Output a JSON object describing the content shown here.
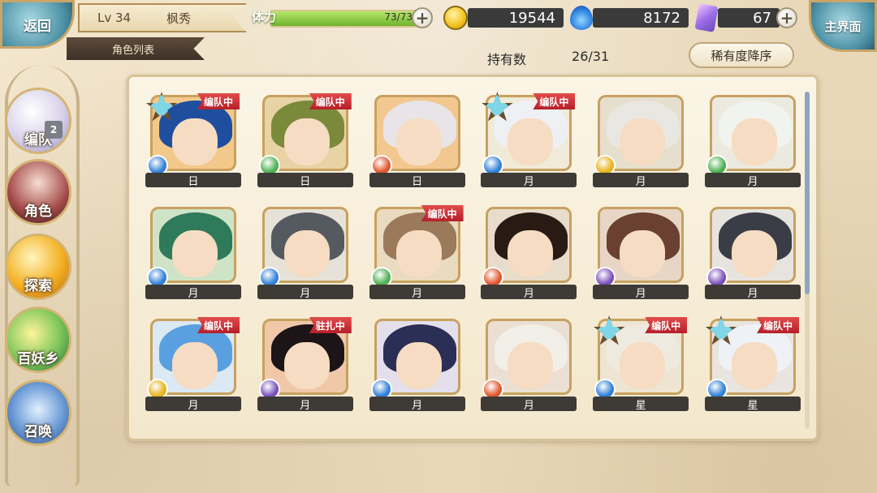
{
  "header": {
    "back_label": "返回",
    "level": "Lv 34",
    "player_name": "枫秀",
    "section_tab": "角色列表",
    "stamina_label": "体力",
    "stamina_value": "73/73",
    "stamina_fraction": 1.0,
    "gold": "19544",
    "spirit": "8172",
    "gems": "67",
    "home_label": "主界面"
  },
  "toolbar": {
    "owned_label": "持有数",
    "owned_value": "26/31",
    "sort_label": "稀有度降序"
  },
  "sidebar": {
    "items": [
      {
        "label": "编队",
        "badge": "2"
      },
      {
        "label": "角色"
      },
      {
        "label": "探索"
      },
      {
        "label": "百妖乡"
      },
      {
        "label": "召唤"
      }
    ]
  },
  "colors": {
    "badge_red": "#c8323a",
    "frame_gold": "#c8a15f",
    "element_water": "#2f7fd6",
    "element_wind": "#4caf50",
    "element_fire": "#e0542a",
    "element_light": "#e8b21a",
    "element_dark": "#7a4fb8"
  },
  "characters": [
    {
      "rank": "日",
      "badge": "编队中",
      "star": true,
      "element": "water",
      "hair": "#1f4e9e",
      "bg": "#f3c98b"
    },
    {
      "rank": "日",
      "badge": "编队中",
      "star": false,
      "element": "wind",
      "hair": "#7a8a3a",
      "bg": "#e8d3a4"
    },
    {
      "rank": "日",
      "badge": "",
      "star": false,
      "element": "fire",
      "hair": "#e8e4e8",
      "bg": "#f2c890"
    },
    {
      "rank": "月",
      "badge": "编队中",
      "star": true,
      "element": "water",
      "hair": "#eef0f4",
      "bg": "#f0ead8"
    },
    {
      "rank": "月",
      "badge": "",
      "star": false,
      "element": "light",
      "hair": "#e9e7e2",
      "bg": "#e6dfcd"
    },
    {
      "rank": "月",
      "badge": "",
      "star": false,
      "element": "wind",
      "hair": "#f1f3ef",
      "bg": "#eceadf"
    },
    {
      "rank": "月",
      "badge": "",
      "star": false,
      "element": "water",
      "hair": "#2e7a5a",
      "bg": "#cfe3c6"
    },
    {
      "rank": "月",
      "badge": "",
      "star": false,
      "element": "water",
      "hair": "#555a60",
      "bg": "#e6e2d8"
    },
    {
      "rank": "月",
      "badge": "编队中",
      "star": false,
      "element": "wind",
      "hair": "#9a7a5a",
      "bg": "#eadac0"
    },
    {
      "rank": "月",
      "badge": "",
      "star": false,
      "element": "fire",
      "hair": "#2a1a14",
      "bg": "#e8dccb"
    },
    {
      "rank": "月",
      "badge": "",
      "star": false,
      "element": "dark",
      "hair": "#6a4030",
      "bg": "#e7d6c5"
    },
    {
      "rank": "月",
      "badge": "",
      "star": false,
      "element": "dark",
      "hair": "#3a3d45",
      "bg": "#e7e4df"
    },
    {
      "rank": "月",
      "badge": "编队中",
      "star": false,
      "element": "light",
      "hair": "#5aa0e0",
      "bg": "#dbe9f4"
    },
    {
      "rank": "月",
      "badge": "驻扎中",
      "star": false,
      "element": "dark",
      "hair": "#1c1416",
      "bg": "#f0c8a8"
    },
    {
      "rank": "月",
      "badge": "",
      "star": false,
      "element": "water",
      "hair": "#2b2e55",
      "bg": "#e3e0ec"
    },
    {
      "rank": "月",
      "badge": "",
      "star": false,
      "element": "fire",
      "hair": "#f2efe8",
      "bg": "#eadfd2"
    },
    {
      "rank": "星",
      "badge": "编队中",
      "star": true,
      "element": "water",
      "hair": "#efeae0",
      "bg": "#ede5d2"
    },
    {
      "rank": "星",
      "badge": "编队中",
      "star": true,
      "element": "water",
      "hair": "#eef2f6",
      "bg": "#e9e4de"
    }
  ]
}
